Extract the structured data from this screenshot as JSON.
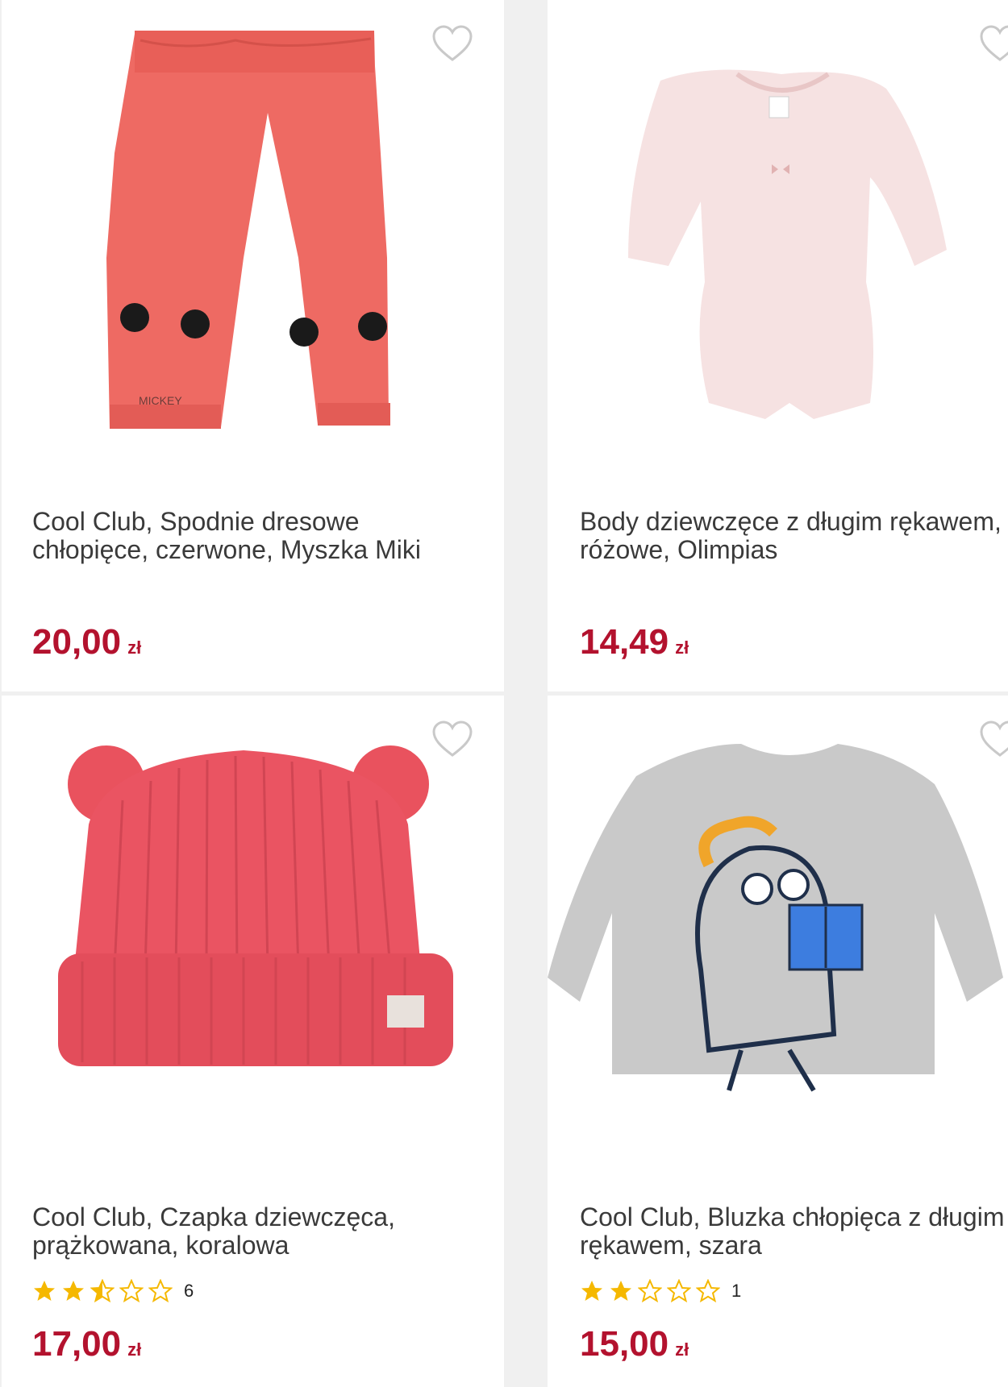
{
  "products": [
    {
      "title": "Cool Club, Spodnie dresowe chłopięce, czerwone, Myszka Miki",
      "price": "20,00",
      "currency": "zł",
      "image_icon": "red-sweatpants-image",
      "print_text": "MICKEY"
    },
    {
      "title": "Body dziewczęce z długim rękawem, różowe, Olimpias",
      "price": "14,49",
      "currency": "zł",
      "image_icon": "pink-bodysuit-image"
    },
    {
      "title": "Cool Club, Czapka dziewczęca, prążkowana, koralowa",
      "price": "17,00",
      "currency": "zł",
      "image_icon": "coral-hat-image",
      "rating": 2.5,
      "rating_count": "6"
    },
    {
      "title": "Cool Club, Bluzka chłopięca z długim rękawem, szara",
      "price": "15,00",
      "currency": "zł",
      "image_icon": "grey-longsleeve-image",
      "rating": 2,
      "rating_count": "1"
    }
  ],
  "colors": {
    "price": "#b3122e",
    "star_filled": "#f5b800",
    "star_empty": "#f5b800",
    "heart_outline": "#c9c9c9",
    "background": "#f0f0f0",
    "card": "#ffffff"
  }
}
